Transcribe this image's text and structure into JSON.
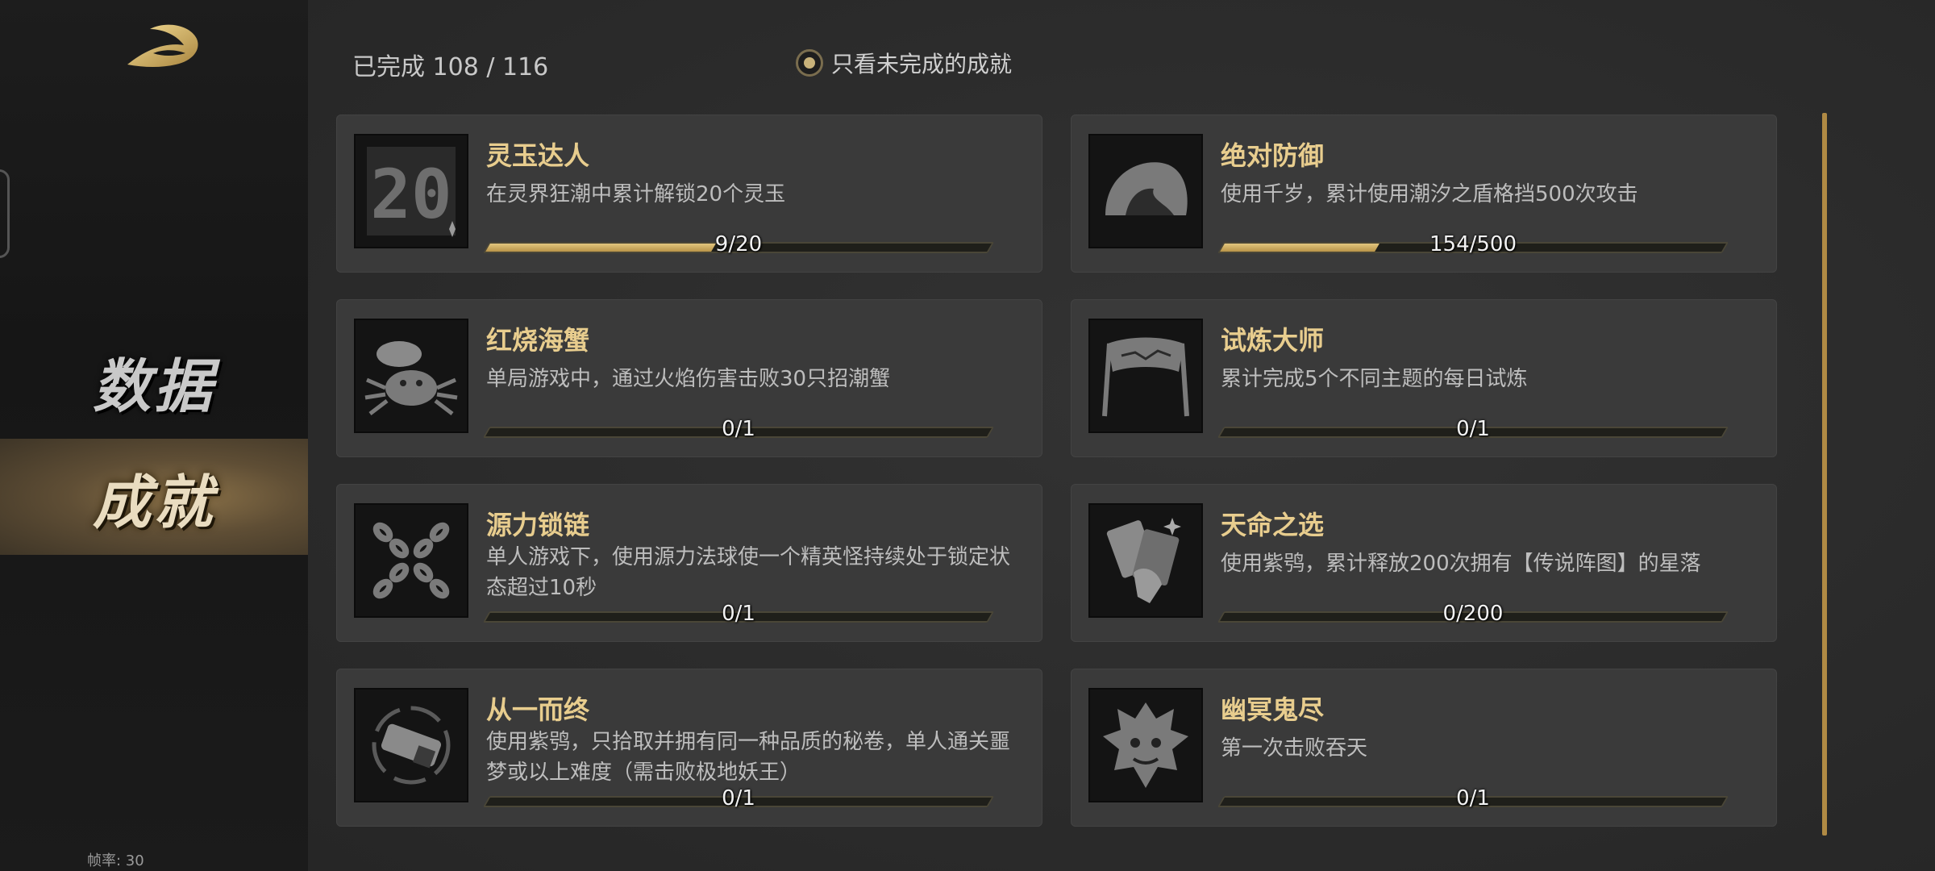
{
  "sidebar": {
    "nav": [
      {
        "label": "数据"
      },
      {
        "label": "成就"
      }
    ],
    "fps": "帧率: 30"
  },
  "header": {
    "completed": "已完成 108 / 116",
    "filter_label": "只看未完成的成就"
  },
  "achievements": [
    {
      "title": "灵玉达人",
      "desc": "在灵界狂潮中累计解锁20个灵玉",
      "progress": "9/20",
      "ratio": 0.45,
      "icon": "tile-20-icon"
    },
    {
      "title": "绝对防御",
      "desc": "使用千岁，累计使用潮汐之盾格挡500次攻击",
      "progress": "154/500",
      "ratio": 0.308,
      "icon": "shield-shell-icon"
    },
    {
      "title": "红烧海蟹",
      "desc": "单局游戏中，通过火焰伤害击败30只招潮蟹",
      "progress": "0/1",
      "ratio": 0,
      "icon": "crab-icon"
    },
    {
      "title": "试炼大师",
      "desc": "累计完成5个不同主题的每日试炼",
      "progress": "0/1",
      "ratio": 0,
      "icon": "banner-icon"
    },
    {
      "title": "源力锁链",
      "desc": "单人游戏下，使用源力法球使一个精英怪持续处于锁定状态超过10秒",
      "progress": "0/1",
      "ratio": 0,
      "icon": "crossed-chains-icon"
    },
    {
      "title": "天命之选",
      "desc": "使用紫鸮，累计释放200次拥有【传说阵图】的星落",
      "progress": "0/200",
      "ratio": 0,
      "icon": "cards-icon"
    },
    {
      "title": "从一而终",
      "desc": "使用紫鸮，只拾取并拥有同一种品质的秘卷，单人通关噩梦或以上难度（需击败极地妖王）",
      "progress": "0/1",
      "ratio": 0,
      "icon": "scroll-icon"
    },
    {
      "title": "幽冥鬼尽",
      "desc": "第一次击败吞天",
      "progress": "0/1",
      "ratio": 0,
      "icon": "demon-mask-icon"
    }
  ],
  "colors": {
    "accent_gold": "#e8cd8e",
    "bar_fill": "#d4b46a",
    "active_nav": "#6e5a3c"
  }
}
